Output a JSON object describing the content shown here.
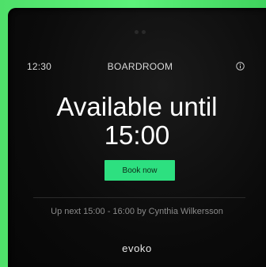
{
  "status_bar": {
    "time": "12:30",
    "room_name": "BOARDROOM",
    "info_icon": "info-icon"
  },
  "availability": {
    "line1": "Available until",
    "line2": "15:00"
  },
  "actions": {
    "book_label": "Book now"
  },
  "upcoming": {
    "text": "Up next 15:00 - 16:00 by Cynthia Wilkersson"
  },
  "brand": {
    "logo_text": "evoko"
  },
  "colors": {
    "frame_glow": "#5cf27a",
    "screen_background": "#0b0b0b",
    "book_button": "#2de080"
  }
}
